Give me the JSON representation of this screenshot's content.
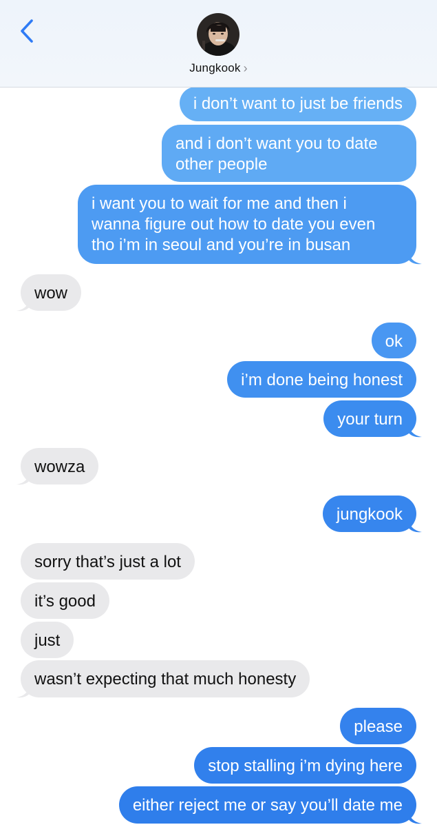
{
  "header": {
    "contact_name": "Jungkook",
    "chevron": "›",
    "back_icon": "chevron-left-icon"
  },
  "colors": {
    "sent_top": "#6cb3f5",
    "sent_bottom": "#2f7ee6",
    "received": "#e9e9eb",
    "accent": "#2f7bf5"
  },
  "messages": [
    {
      "from": "me",
      "text": "i don’t want to just be friends"
    },
    {
      "from": "me",
      "lines": [
        "and i don’t want you to date",
        "other people"
      ]
    },
    {
      "from": "me",
      "lines": [
        "i want you to wait for me and then i",
        "wanna figure out how to date you even",
        "tho i’m in seoul and you’re in busan"
      ]
    },
    {
      "from": "them",
      "text": "wow"
    },
    {
      "from": "me",
      "text": "ok"
    },
    {
      "from": "me",
      "text": "i’m done being honest"
    },
    {
      "from": "me",
      "text": "your turn"
    },
    {
      "from": "them",
      "text": "wowza"
    },
    {
      "from": "me",
      "text": "jungkook"
    },
    {
      "from": "them",
      "text": "sorry that’s just a lot"
    },
    {
      "from": "them",
      "text": "it’s good"
    },
    {
      "from": "them",
      "text": "just"
    },
    {
      "from": "them",
      "text": "wasn’t expecting that much honesty"
    },
    {
      "from": "me",
      "text": "please"
    },
    {
      "from": "me",
      "text": "stop stalling i’m dying here"
    },
    {
      "from": "me",
      "text": "either reject me or say you’ll date me"
    }
  ]
}
